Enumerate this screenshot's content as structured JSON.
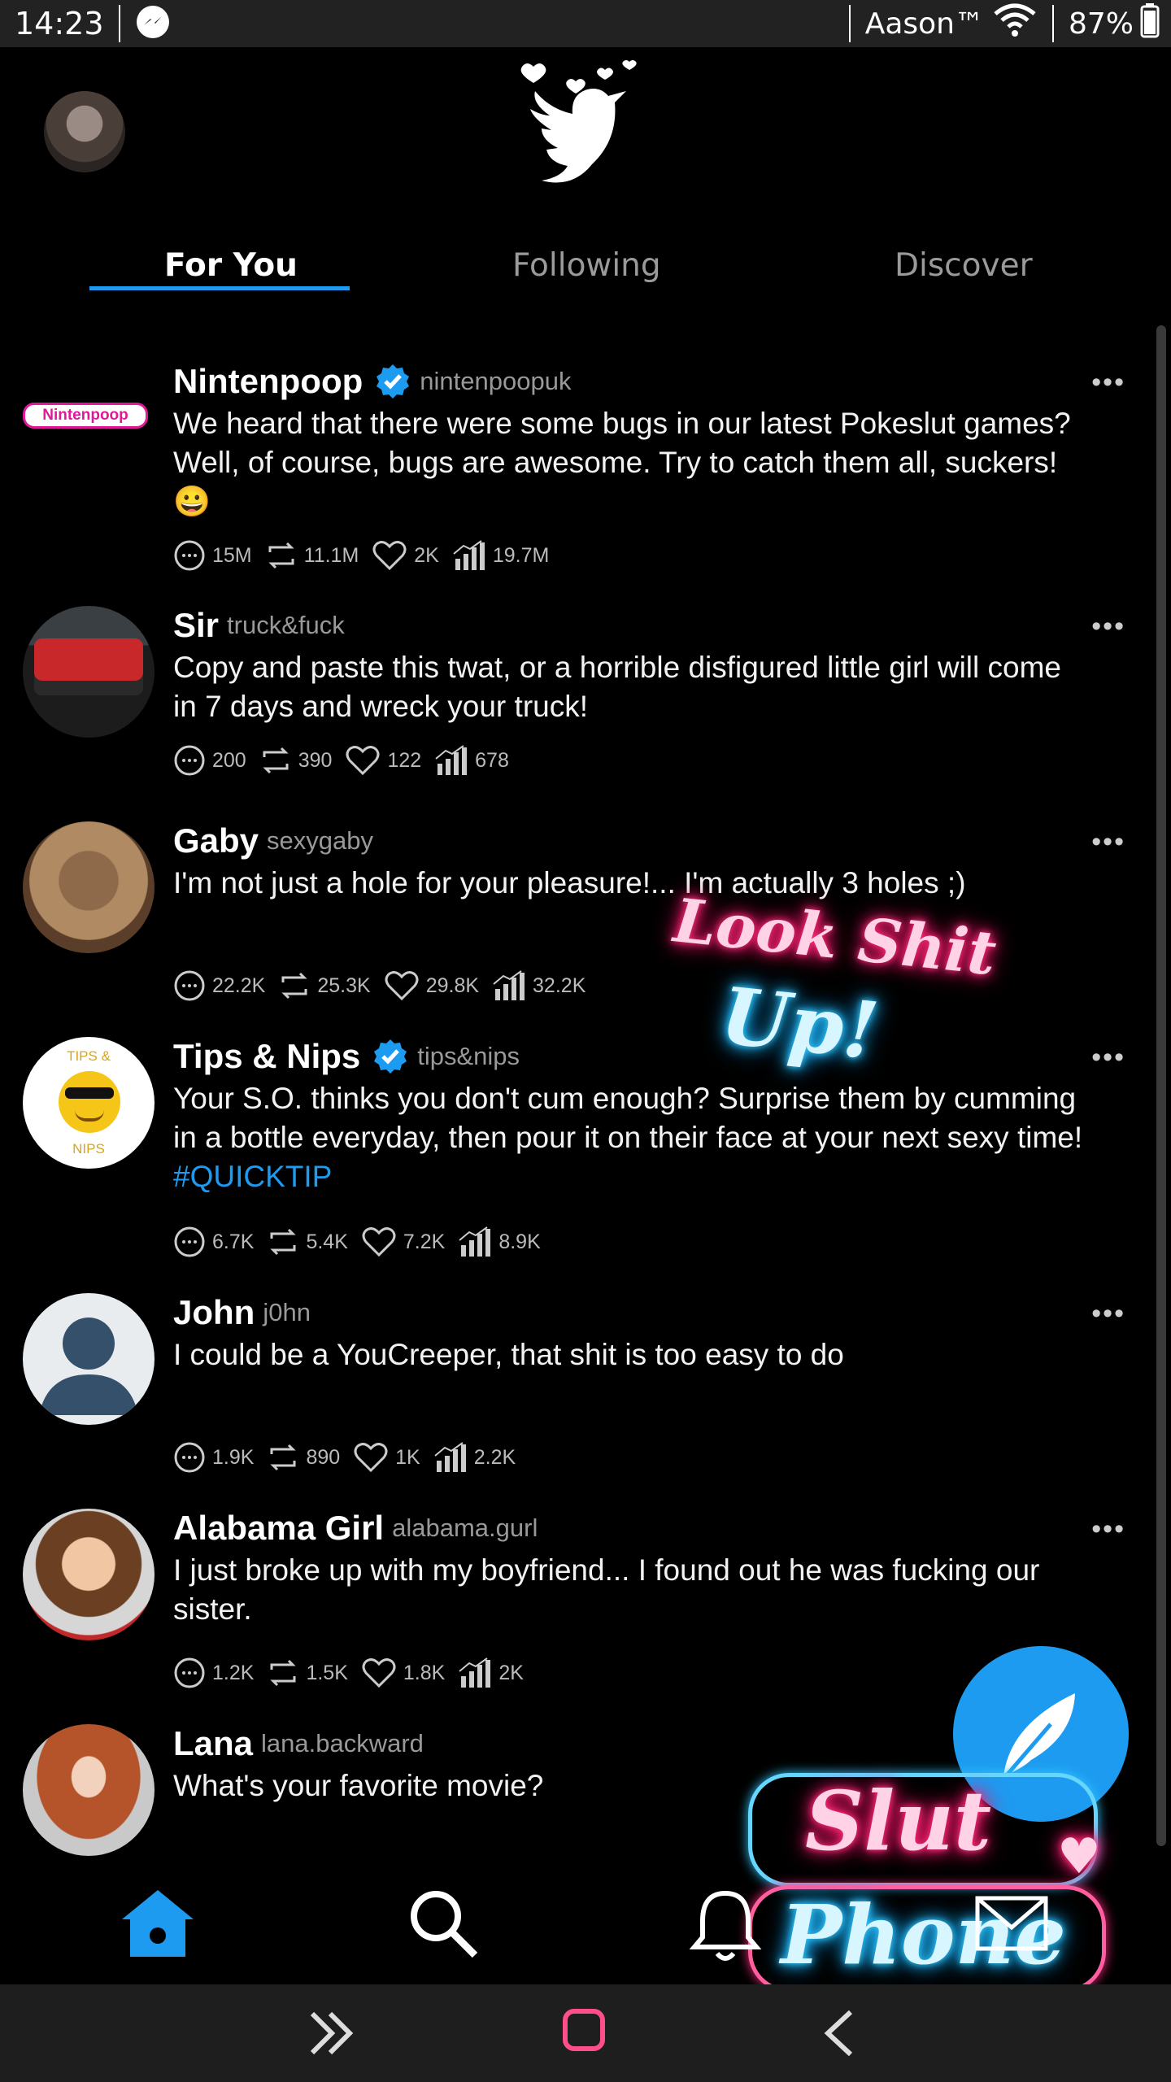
{
  "status_bar": {
    "time": "14:23",
    "carrier": "Aason™",
    "battery": "87%"
  },
  "tabs": [
    {
      "label": "For You",
      "active": true
    },
    {
      "label": "Following",
      "active": false
    },
    {
      "label": "Discover",
      "active": false
    }
  ],
  "posts": [
    {
      "name": "Nintenpoop",
      "handle": "nintenpoopuk",
      "verified": true,
      "avatar_text": "Nintenpoop",
      "text": "We heard that there were some bugs in our latest Pokeslut games? Well, of course, bugs are awesome. Try to catch them all, suckers! 😀",
      "replies": "15M",
      "reposts": "11.1M",
      "likes": "2K",
      "views": "19.7M"
    },
    {
      "name": "Sir",
      "handle": "truck&fuck",
      "verified": false,
      "text": "Copy and paste this twat, or a horrible disfigured little girl will come in 7 days and wreck your truck!",
      "replies": "200",
      "reposts": "390",
      "likes": "122",
      "views": "678"
    },
    {
      "name": "Gaby",
      "handle": "sexygaby",
      "verified": false,
      "text": "I'm not just a hole for your pleasure!... I'm actually 3 holes ;)",
      "replies": "22.2K",
      "reposts": "25.3K",
      "likes": "29.8K",
      "views": "32.2K"
    },
    {
      "name": "Tips & Nips",
      "handle": "tips&nips",
      "verified": true,
      "avatar_text_top": "TIPS &",
      "avatar_text_bottom": "NIPS",
      "text": "Your S.O. thinks you don't cum enough? Surprise them by cumming in a bottle everyday, then pour it on their face at your next sexy time!",
      "hashtag": "#QUICKTIP",
      "replies": "6.7K",
      "reposts": "5.4K",
      "likes": "7.2K",
      "views": "8.9K"
    },
    {
      "name": "John",
      "handle": "j0hn",
      "verified": false,
      "text": "I could be a YouCreeper, that shit is too easy to do",
      "replies": "1.9K",
      "reposts": "890",
      "likes": "1K",
      "views": "2.2K"
    },
    {
      "name": "Alabama Girl",
      "handle": "alabama.gurl",
      "verified": false,
      "text": "I just broke up with my boyfriend... I found out he was fucking our sister.",
      "replies": "1.2K",
      "reposts": "1.5K",
      "likes": "1.8K",
      "views": "2K"
    },
    {
      "name": "Lana",
      "handle": "lana.backward",
      "verified": false,
      "text": "What's your favorite movie?"
    }
  ],
  "overlays": {
    "neon_1_line1": "Look Shit",
    "neon_1_line2": "Up!",
    "neon_2_line1": "Slut",
    "neon_2_line2": "Phone"
  },
  "more_label": "•••",
  "colors": {
    "accent": "#1d9bf0",
    "background": "#000000",
    "neon_pink": "#ff2a7a",
    "neon_blue": "#2fc7ff"
  }
}
